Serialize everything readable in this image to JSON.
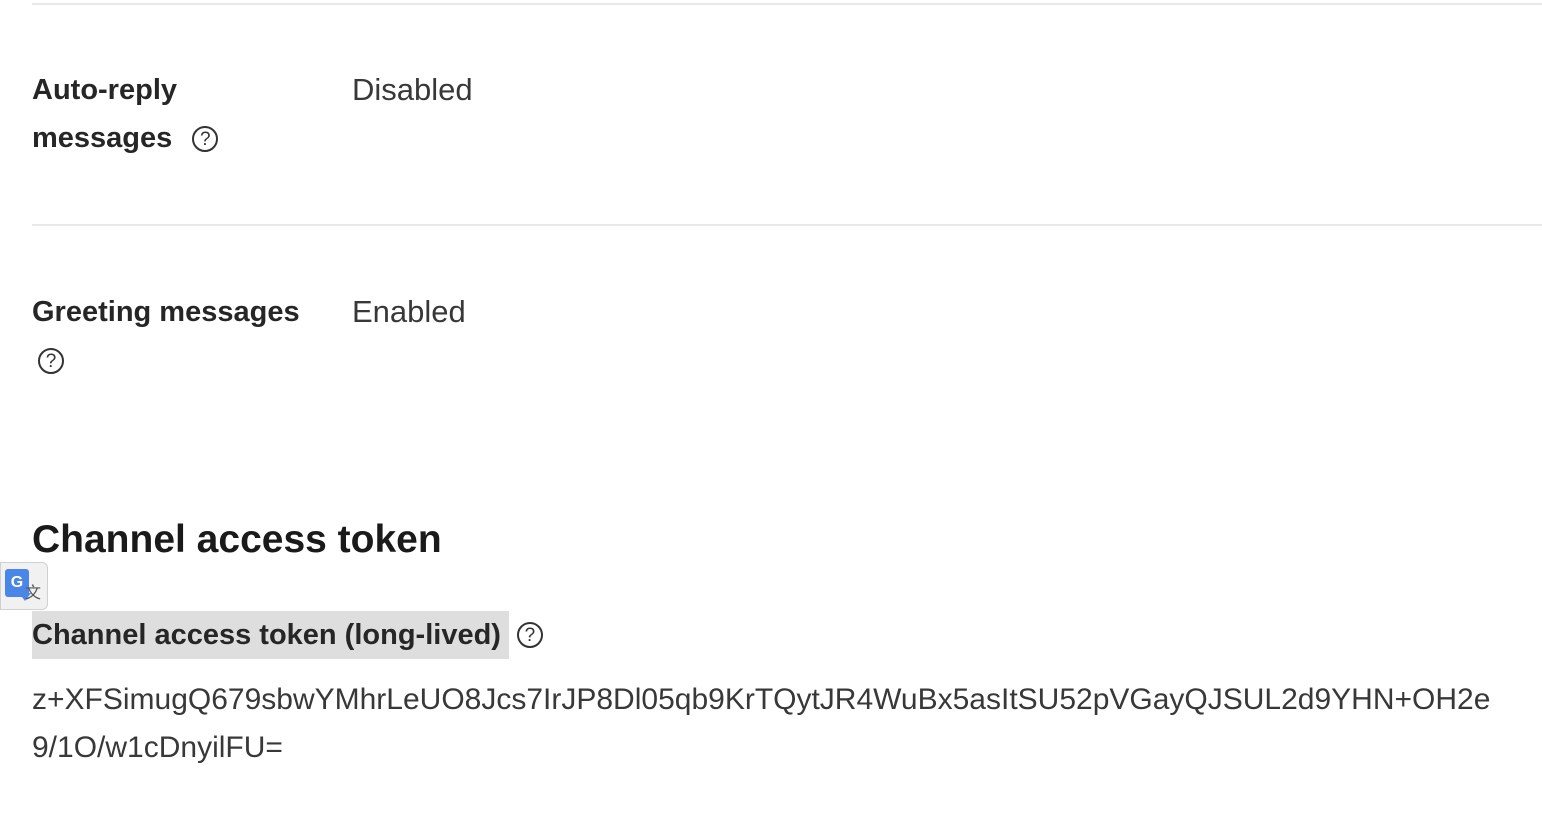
{
  "settings": {
    "auto_reply": {
      "label_line1": "Auto-reply",
      "label_line2": "messages",
      "value": "Disabled",
      "help_glyph": "?"
    },
    "greeting": {
      "label": "Greeting messages",
      "value": "Enabled",
      "help_glyph": "?"
    }
  },
  "token_section": {
    "title": "Channel access token",
    "long_lived_label": "Channel access token (long-lived)",
    "help_glyph": "?",
    "value_line1": "z+XFSimugQ679sbwYMhrLeUO8Jcs7IrJP8Dl05qb9KrTQytJR4WuBx5asItSU52pVGayQJSUL2d9YHN+OH2e",
    "value_line2": "9/1O/w1cDnyilFU="
  },
  "translate_widget": {
    "icon": "google-translate-icon",
    "g_letter": "G",
    "zh_glyph": "文"
  }
}
